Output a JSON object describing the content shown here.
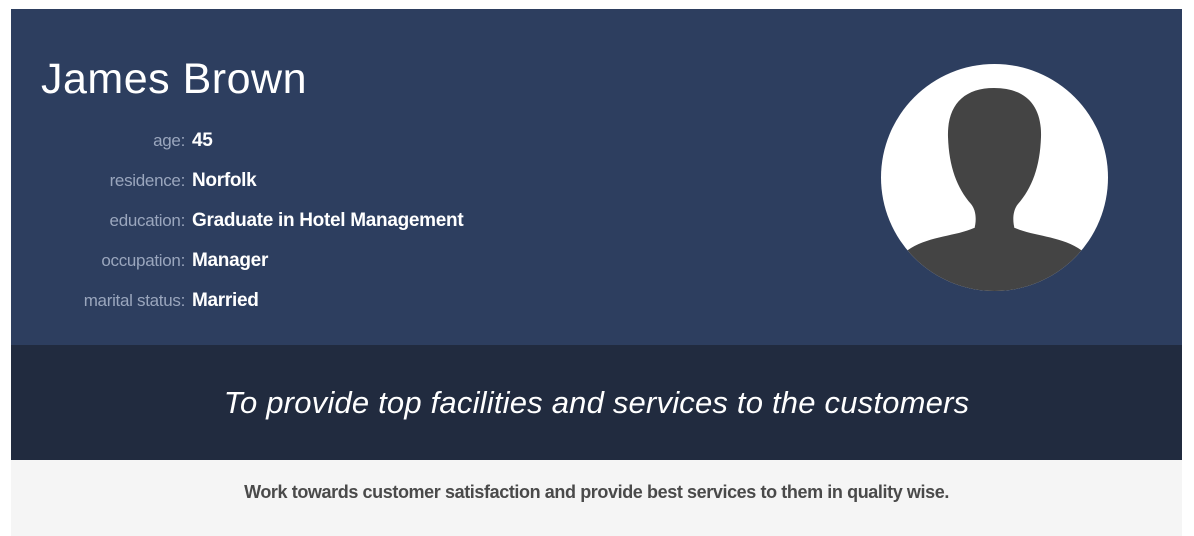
{
  "profile": {
    "name": "James Brown",
    "details": [
      {
        "label": "age:",
        "value": "45"
      },
      {
        "label": "residence:",
        "value": "Norfolk"
      },
      {
        "label": "education:",
        "value": "Graduate in Hotel Management"
      },
      {
        "label": "occupation:",
        "value": "Manager"
      },
      {
        "label": "marital status:",
        "value": "Married"
      }
    ],
    "avatar_icon": "person-silhouette-icon"
  },
  "goal": {
    "text": "To provide top facilities and services to the customers"
  },
  "description": {
    "text": "Work towards customer satisfaction and provide best services to them in quality wise."
  },
  "colors": {
    "header_bg": "#2d3e5f",
    "goal_bg": "#212b3f",
    "description_bg": "#f5f5f5",
    "label_text": "#9aa6bd",
    "avatar_silhouette": "#444444"
  }
}
